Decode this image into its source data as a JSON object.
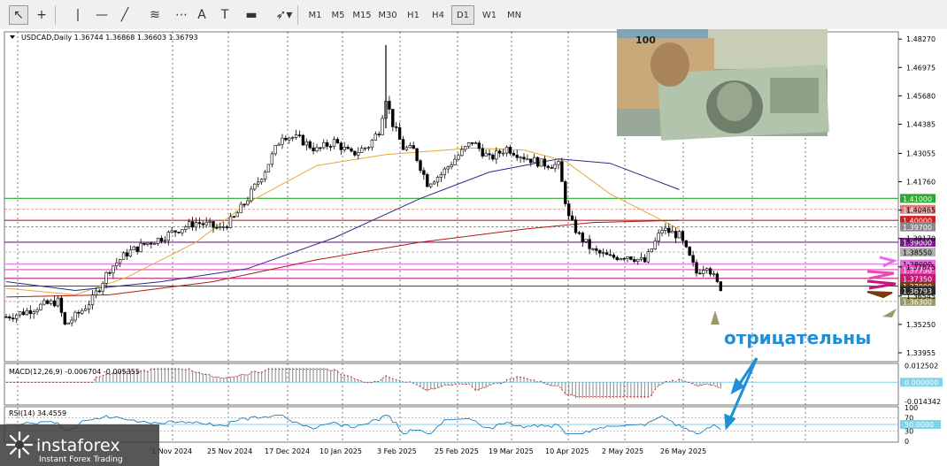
{
  "toolbar": {
    "tools": [
      {
        "name": "cursor-tool",
        "glyph": "↖"
      },
      {
        "name": "crosshair-tool",
        "glyph": "+"
      },
      {
        "name": "vertical-line-tool",
        "glyph": "|"
      },
      {
        "name": "horizontal-line-tool",
        "glyph": "—"
      },
      {
        "name": "trendline-tool",
        "glyph": "╱"
      },
      {
        "name": "fibonacci-tool",
        "glyph": "≋"
      },
      {
        "name": "grid-tool",
        "glyph": "⋯"
      },
      {
        "name": "text-tool",
        "glyph": "A"
      },
      {
        "name": "text-label-tool",
        "glyph": "T"
      },
      {
        "name": "rectangle-tool",
        "glyph": "▬"
      },
      {
        "name": "arrows-tool",
        "glyph": "➶▾"
      }
    ],
    "timeframes": [
      "M1",
      "M5",
      "M15",
      "M30",
      "H1",
      "H4",
      "D1",
      "W1",
      "MN"
    ],
    "active_timeframe": "D1"
  },
  "chart_data": {
    "type": "candlestick",
    "symbol_header": "USDCAD,Daily  1.36744 1.36868 1.36603 1.36793",
    "price_axis_ticks": [
      "1.48270",
      "1.46975",
      "1.45680",
      "1.44385",
      "1.43055",
      "1.41760",
      "1.40465",
      "1.39170",
      "1.37875",
      "1.36545",
      "1.35250",
      "1.33955"
    ],
    "ylim": [
      1.3355,
      1.486
    ],
    "date_labels": [
      "10 Oct 2024",
      "1 Nov 2024",
      "25 Nov 2024",
      "17 Dec 2024",
      "10 Jan 2025",
      "3 Feb 2025",
      "25 Feb 2025",
      "19 Mar 2025",
      "10 Apr 2025",
      "2 May 2025",
      "26 May 2025"
    ],
    "close_anchors": [
      [
        0,
        1.356
      ],
      [
        5,
        1.358
      ],
      [
        10,
        1.361
      ],
      [
        15,
        1.363
      ],
      [
        17,
        1.352
      ],
      [
        22,
        1.359
      ],
      [
        25,
        1.364
      ],
      [
        30,
        1.378
      ],
      [
        35,
        1.385
      ],
      [
        40,
        1.389
      ],
      [
        45,
        1.392
      ],
      [
        50,
        1.396
      ],
      [
        55,
        1.399
      ],
      [
        58,
        1.398
      ],
      [
        62,
        1.396
      ],
      [
        66,
        1.401
      ],
      [
        70,
        1.41
      ],
      [
        75,
        1.423
      ],
      [
        80,
        1.439
      ],
      [
        85,
        1.437
      ],
      [
        90,
        1.432
      ],
      [
        95,
        1.436
      ],
      [
        100,
        1.43
      ],
      [
        105,
        1.434
      ],
      [
        108,
        1.441
      ],
      [
        110,
        1.456
      ],
      [
        112,
        1.444
      ],
      [
        115,
        1.433
      ],
      [
        118,
        1.432
      ],
      [
        122,
        1.417
      ],
      [
        126,
        1.421
      ],
      [
        130,
        1.428
      ],
      [
        135,
        1.436
      ],
      [
        140,
        1.428
      ],
      [
        145,
        1.433
      ],
      [
        150,
        1.429
      ],
      [
        155,
        1.426
      ],
      [
        160,
        1.425
      ],
      [
        163,
        1.401
      ],
      [
        166,
        1.393
      ],
      [
        170,
        1.386
      ],
      [
        175,
        1.383
      ],
      [
        180,
        1.384
      ],
      [
        185,
        1.381
      ],
      [
        190,
        1.396
      ],
      [
        195,
        1.393
      ],
      [
        200,
        1.376
      ],
      [
        203,
        1.38
      ],
      [
        207,
        1.3679
      ]
    ],
    "moving_averages": [
      {
        "color": "#e6a833",
        "points": [
          [
            0,
            1.369
          ],
          [
            20,
            1.366
          ],
          [
            35,
            1.374
          ],
          [
            55,
            1.39
          ],
          [
            70,
            1.408
          ],
          [
            90,
            1.425
          ],
          [
            110,
            1.43
          ],
          [
            135,
            1.433
          ],
          [
            150,
            1.432
          ],
          [
            162,
            1.427
          ],
          [
            175,
            1.412
          ],
          [
            195,
            1.396
          ]
        ]
      },
      {
        "color": "#2a2a8c",
        "points": [
          [
            0,
            1.372
          ],
          [
            20,
            1.368
          ],
          [
            45,
            1.372
          ],
          [
            70,
            1.378
          ],
          [
            95,
            1.392
          ],
          [
            120,
            1.41
          ],
          [
            140,
            1.422
          ],
          [
            160,
            1.428
          ],
          [
            175,
            1.426
          ],
          [
            195,
            1.414
          ]
        ]
      },
      {
        "color": "#b01818",
        "points": [
          [
            0,
            1.365
          ],
          [
            30,
            1.366
          ],
          [
            60,
            1.372
          ],
          [
            90,
            1.382
          ],
          [
            120,
            1.39
          ],
          [
            150,
            1.396
          ],
          [
            170,
            1.399
          ],
          [
            195,
            1.4
          ]
        ]
      }
    ],
    "levels": [
      {
        "label": "1.41000",
        "value": 1.41,
        "color": "#2ea82e"
      },
      {
        "label": "1.40500",
        "value": 1.405,
        "color": "#e07b7b"
      },
      {
        "label": "1.40000",
        "value": 1.4,
        "color": "#d21e1e"
      },
      {
        "label": "1.39700",
        "value": 1.397,
        "color": "#888888"
      },
      {
        "label": "1.39000",
        "value": 1.39,
        "color": "#7a1a8c"
      },
      {
        "label": "1.38550",
        "value": 1.3855,
        "color": "#b0b0b0"
      },
      {
        "label": "1.38000",
        "value": 1.38,
        "color": "#e66ee6"
      },
      {
        "label": "1.37750",
        "value": 1.3775,
        "color": "#e84ab8"
      },
      {
        "label": "1.37350",
        "value": 1.3735,
        "color": "#c21878"
      },
      {
        "label": "1.37000",
        "value": 1.37,
        "color": "#7a3a14"
      },
      {
        "label": "1.36793",
        "value": 1.36793,
        "color": "#2a2a2a"
      },
      {
        "label": "1.36300",
        "value": 1.363,
        "color": "#9a9a66"
      }
    ],
    "macd": {
      "header": "MACD(12,26,9) -0.006704 -0.005355",
      "ticks": [
        "0.012502",
        "0.000000",
        "-0.014342"
      ],
      "ylim": [
        -0.0165,
        0.0135
      ]
    },
    "rsi": {
      "header": "RSI(14) 34.4559",
      "ticks": [
        "100",
        "70",
        "50.0000",
        "30",
        "0"
      ],
      "ylim": [
        0,
        100
      ]
    },
    "annotation_text": "отрицательны"
  },
  "banner_text": "100",
  "branding": {
    "name": "instaforex",
    "tagline": "Instant Forex Trading"
  }
}
